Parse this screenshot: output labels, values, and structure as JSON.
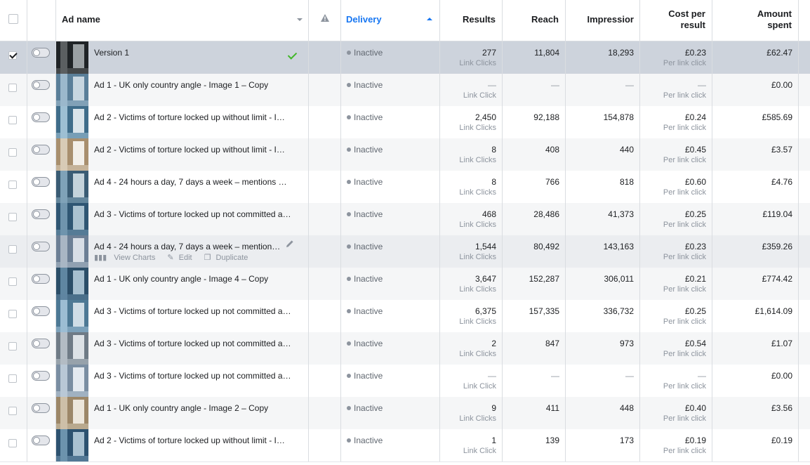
{
  "header": {
    "ad_name": "Ad name",
    "delivery": "Delivery",
    "results": "Results",
    "reach": "Reach",
    "impressions": "Impressior",
    "cost_line1": "Cost per",
    "cost_line2": "result",
    "amount_line1": "Amount",
    "amount_line2": "spent"
  },
  "row_actions": {
    "view_charts": "View Charts",
    "edit": "Edit",
    "duplicate": "Duplicate"
  },
  "colors": {
    "accent": "#1877f2",
    "selected_row": "#cdd3dc",
    "success": "#42b72a"
  },
  "rows": [
    {
      "name": "Version 1",
      "delivery": "Inactive",
      "results": "277",
      "results_label": "Link Clicks",
      "reach": "11,804",
      "impressions": "18,293",
      "cost": "£0.23",
      "cost_label": "Per link click",
      "amount": "£62.47"
    },
    {
      "name": "Ad 1 - UK only country angle - Image 1 – Copy",
      "delivery": "Inactive",
      "results": "—",
      "results_label": "Link Click",
      "reach": "—",
      "impressions": "—",
      "cost": "—",
      "cost_label": "Per link click",
      "amount": "£0.00"
    },
    {
      "name": "Ad 2 - Victims of torture locked up without limit - I…",
      "delivery": "Inactive",
      "results": "2,450",
      "results_label": "Link Clicks",
      "reach": "92,188",
      "impressions": "154,878",
      "cost": "£0.24",
      "cost_label": "Per link click",
      "amount": "£585.69"
    },
    {
      "name": "Ad 2 - Victims of torture locked up without limit - I…",
      "delivery": "Inactive",
      "results": "8",
      "results_label": "Link Clicks",
      "reach": "408",
      "impressions": "440",
      "cost": "£0.45",
      "cost_label": "Per link click",
      "amount": "£3.57"
    },
    {
      "name": "Ad 4 - 24 hours a day, 7 days a week – mentions …",
      "delivery": "Inactive",
      "results": "8",
      "results_label": "Link Clicks",
      "reach": "766",
      "impressions": "818",
      "cost": "£0.60",
      "cost_label": "Per link click",
      "amount": "£4.76"
    },
    {
      "name": "Ad 3 - Victims of torture locked up not committed a…",
      "delivery": "Inactive",
      "results": "468",
      "results_label": "Link Clicks",
      "reach": "28,486",
      "impressions": "41,373",
      "cost": "£0.25",
      "cost_label": "Per link click",
      "amount": "£119.04"
    },
    {
      "name": "Ad 4 - 24 hours a day, 7 days a week – mention…",
      "delivery": "Inactive",
      "results": "1,544",
      "results_label": "Link Clicks",
      "reach": "80,492",
      "impressions": "143,163",
      "cost": "£0.23",
      "cost_label": "Per link click",
      "amount": "£359.26"
    },
    {
      "name": "Ad 1 - UK only country angle - Image 4 – Copy",
      "delivery": "Inactive",
      "results": "3,647",
      "results_label": "Link Clicks",
      "reach": "152,287",
      "impressions": "306,011",
      "cost": "£0.21",
      "cost_label": "Per link click",
      "amount": "£774.42"
    },
    {
      "name": "Ad 3 - Victims of torture locked up not committed a…",
      "delivery": "Inactive",
      "results": "6,375",
      "results_label": "Link Clicks",
      "reach": "157,335",
      "impressions": "336,732",
      "cost": "£0.25",
      "cost_label": "Per link click",
      "amount": "£1,614.09"
    },
    {
      "name": "Ad 3 - Victims of torture locked up not committed a…",
      "delivery": "Inactive",
      "results": "2",
      "results_label": "Link Clicks",
      "reach": "847",
      "impressions": "973",
      "cost": "£0.54",
      "cost_label": "Per link click",
      "amount": "£1.07"
    },
    {
      "name": "Ad 3 - Victims of torture locked up not committed a…",
      "delivery": "Inactive",
      "results": "—",
      "results_label": "Link Click",
      "reach": "—",
      "impressions": "—",
      "cost": "—",
      "cost_label": "Per link click",
      "amount": "£0.00"
    },
    {
      "name": "Ad 1 - UK only country angle - Image 2 – Copy",
      "delivery": "Inactive",
      "results": "9",
      "results_label": "Link Clicks",
      "reach": "411",
      "impressions": "448",
      "cost": "£0.40",
      "cost_label": "Per link click",
      "amount": "£3.56"
    },
    {
      "name": "Ad 2 - Victims of torture locked up without limit - I…",
      "delivery": "Inactive",
      "results": "1",
      "results_label": "Link Click",
      "reach": "139",
      "impressions": "173",
      "cost": "£0.19",
      "cost_label": "Per link click",
      "amount": "£0.19"
    }
  ]
}
